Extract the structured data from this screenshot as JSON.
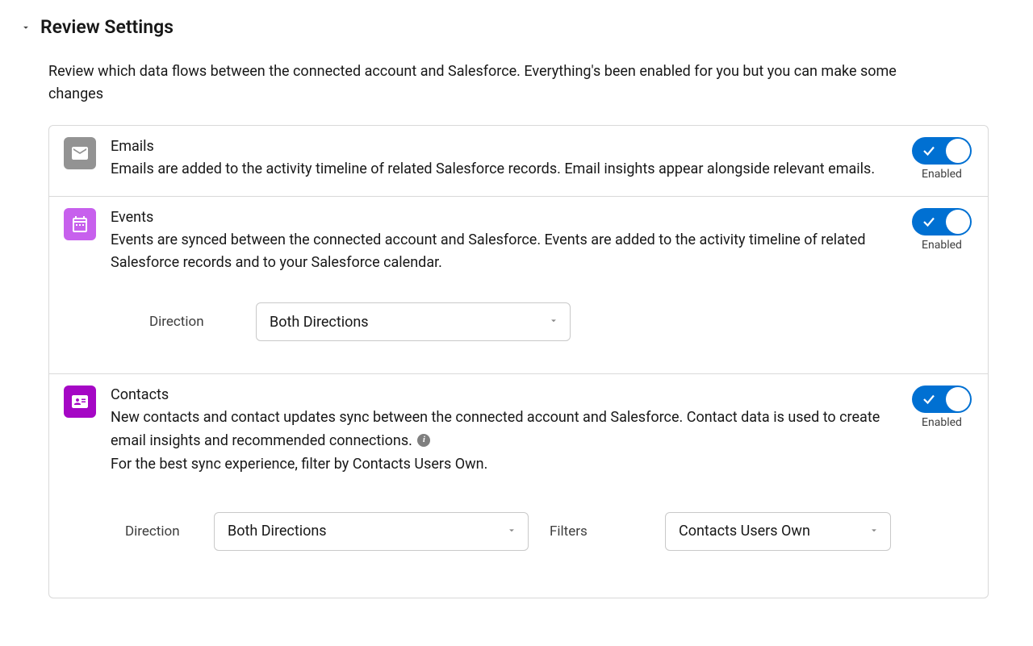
{
  "header": {
    "title": "Review Settings",
    "description": "Review which data flows between the connected account and Salesforce. Everything's been enabled for you but you can make some changes"
  },
  "toggle": {
    "enabled_label": "Enabled"
  },
  "emails": {
    "title": "Emails",
    "desc": "Emails are added to the activity timeline of related Salesforce records. Email insights appear alongside relevant emails."
  },
  "events": {
    "title": "Events",
    "desc": "Events are synced between the connected account and Salesforce. Events are added to the activity timeline of related Salesforce records and to your Salesforce calendar.",
    "direction_label": "Direction",
    "direction_value": "Both Directions"
  },
  "contacts": {
    "title": "Contacts",
    "desc1": "New contacts and contact updates sync between the connected account and Salesforce. Contact data is used to create email insights and recommended connections.",
    "desc2": "For the best sync experience, filter by Contacts Users Own.",
    "direction_label": "Direction",
    "direction_value": "Both Directions",
    "filters_label": "Filters",
    "filters_value": "Contacts Users Own"
  }
}
